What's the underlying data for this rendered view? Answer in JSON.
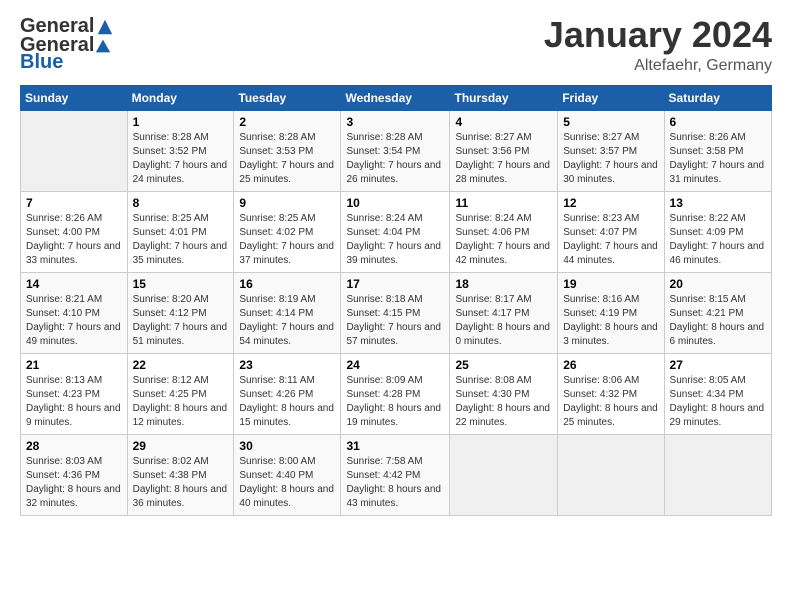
{
  "logo": {
    "general": "General",
    "blue": "Blue"
  },
  "header": {
    "month": "January 2024",
    "location": "Altefaehr, Germany"
  },
  "weekdays": [
    "Sunday",
    "Monday",
    "Tuesday",
    "Wednesday",
    "Thursday",
    "Friday",
    "Saturday"
  ],
  "weeks": [
    [
      {
        "day": "",
        "sunrise": "",
        "sunset": "",
        "daylight": ""
      },
      {
        "day": "1",
        "sunrise": "Sunrise: 8:28 AM",
        "sunset": "Sunset: 3:52 PM",
        "daylight": "Daylight: 7 hours and 24 minutes."
      },
      {
        "day": "2",
        "sunrise": "Sunrise: 8:28 AM",
        "sunset": "Sunset: 3:53 PM",
        "daylight": "Daylight: 7 hours and 25 minutes."
      },
      {
        "day": "3",
        "sunrise": "Sunrise: 8:28 AM",
        "sunset": "Sunset: 3:54 PM",
        "daylight": "Daylight: 7 hours and 26 minutes."
      },
      {
        "day": "4",
        "sunrise": "Sunrise: 8:27 AM",
        "sunset": "Sunset: 3:56 PM",
        "daylight": "Daylight: 7 hours and 28 minutes."
      },
      {
        "day": "5",
        "sunrise": "Sunrise: 8:27 AM",
        "sunset": "Sunset: 3:57 PM",
        "daylight": "Daylight: 7 hours and 30 minutes."
      },
      {
        "day": "6",
        "sunrise": "Sunrise: 8:26 AM",
        "sunset": "Sunset: 3:58 PM",
        "daylight": "Daylight: 7 hours and 31 minutes."
      }
    ],
    [
      {
        "day": "7",
        "sunrise": "Sunrise: 8:26 AM",
        "sunset": "Sunset: 4:00 PM",
        "daylight": "Daylight: 7 hours and 33 minutes."
      },
      {
        "day": "8",
        "sunrise": "Sunrise: 8:25 AM",
        "sunset": "Sunset: 4:01 PM",
        "daylight": "Daylight: 7 hours and 35 minutes."
      },
      {
        "day": "9",
        "sunrise": "Sunrise: 8:25 AM",
        "sunset": "Sunset: 4:02 PM",
        "daylight": "Daylight: 7 hours and 37 minutes."
      },
      {
        "day": "10",
        "sunrise": "Sunrise: 8:24 AM",
        "sunset": "Sunset: 4:04 PM",
        "daylight": "Daylight: 7 hours and 39 minutes."
      },
      {
        "day": "11",
        "sunrise": "Sunrise: 8:24 AM",
        "sunset": "Sunset: 4:06 PM",
        "daylight": "Daylight: 7 hours and 42 minutes."
      },
      {
        "day": "12",
        "sunrise": "Sunrise: 8:23 AM",
        "sunset": "Sunset: 4:07 PM",
        "daylight": "Daylight: 7 hours and 44 minutes."
      },
      {
        "day": "13",
        "sunrise": "Sunrise: 8:22 AM",
        "sunset": "Sunset: 4:09 PM",
        "daylight": "Daylight: 7 hours and 46 minutes."
      }
    ],
    [
      {
        "day": "14",
        "sunrise": "Sunrise: 8:21 AM",
        "sunset": "Sunset: 4:10 PM",
        "daylight": "Daylight: 7 hours and 49 minutes."
      },
      {
        "day": "15",
        "sunrise": "Sunrise: 8:20 AM",
        "sunset": "Sunset: 4:12 PM",
        "daylight": "Daylight: 7 hours and 51 minutes."
      },
      {
        "day": "16",
        "sunrise": "Sunrise: 8:19 AM",
        "sunset": "Sunset: 4:14 PM",
        "daylight": "Daylight: 7 hours and 54 minutes."
      },
      {
        "day": "17",
        "sunrise": "Sunrise: 8:18 AM",
        "sunset": "Sunset: 4:15 PM",
        "daylight": "Daylight: 7 hours and 57 minutes."
      },
      {
        "day": "18",
        "sunrise": "Sunrise: 8:17 AM",
        "sunset": "Sunset: 4:17 PM",
        "daylight": "Daylight: 8 hours and 0 minutes."
      },
      {
        "day": "19",
        "sunrise": "Sunrise: 8:16 AM",
        "sunset": "Sunset: 4:19 PM",
        "daylight": "Daylight: 8 hours and 3 minutes."
      },
      {
        "day": "20",
        "sunrise": "Sunrise: 8:15 AM",
        "sunset": "Sunset: 4:21 PM",
        "daylight": "Daylight: 8 hours and 6 minutes."
      }
    ],
    [
      {
        "day": "21",
        "sunrise": "Sunrise: 8:13 AM",
        "sunset": "Sunset: 4:23 PM",
        "daylight": "Daylight: 8 hours and 9 minutes."
      },
      {
        "day": "22",
        "sunrise": "Sunrise: 8:12 AM",
        "sunset": "Sunset: 4:25 PM",
        "daylight": "Daylight: 8 hours and 12 minutes."
      },
      {
        "day": "23",
        "sunrise": "Sunrise: 8:11 AM",
        "sunset": "Sunset: 4:26 PM",
        "daylight": "Daylight: 8 hours and 15 minutes."
      },
      {
        "day": "24",
        "sunrise": "Sunrise: 8:09 AM",
        "sunset": "Sunset: 4:28 PM",
        "daylight": "Daylight: 8 hours and 19 minutes."
      },
      {
        "day": "25",
        "sunrise": "Sunrise: 8:08 AM",
        "sunset": "Sunset: 4:30 PM",
        "daylight": "Daylight: 8 hours and 22 minutes."
      },
      {
        "day": "26",
        "sunrise": "Sunrise: 8:06 AM",
        "sunset": "Sunset: 4:32 PM",
        "daylight": "Daylight: 8 hours and 25 minutes."
      },
      {
        "day": "27",
        "sunrise": "Sunrise: 8:05 AM",
        "sunset": "Sunset: 4:34 PM",
        "daylight": "Daylight: 8 hours and 29 minutes."
      }
    ],
    [
      {
        "day": "28",
        "sunrise": "Sunrise: 8:03 AM",
        "sunset": "Sunset: 4:36 PM",
        "daylight": "Daylight: 8 hours and 32 minutes."
      },
      {
        "day": "29",
        "sunrise": "Sunrise: 8:02 AM",
        "sunset": "Sunset: 4:38 PM",
        "daylight": "Daylight: 8 hours and 36 minutes."
      },
      {
        "day": "30",
        "sunrise": "Sunrise: 8:00 AM",
        "sunset": "Sunset: 4:40 PM",
        "daylight": "Daylight: 8 hours and 40 minutes."
      },
      {
        "day": "31",
        "sunrise": "Sunrise: 7:58 AM",
        "sunset": "Sunset: 4:42 PM",
        "daylight": "Daylight: 8 hours and 43 minutes."
      },
      {
        "day": "",
        "sunrise": "",
        "sunset": "",
        "daylight": ""
      },
      {
        "day": "",
        "sunrise": "",
        "sunset": "",
        "daylight": ""
      },
      {
        "day": "",
        "sunrise": "",
        "sunset": "",
        "daylight": ""
      }
    ]
  ]
}
